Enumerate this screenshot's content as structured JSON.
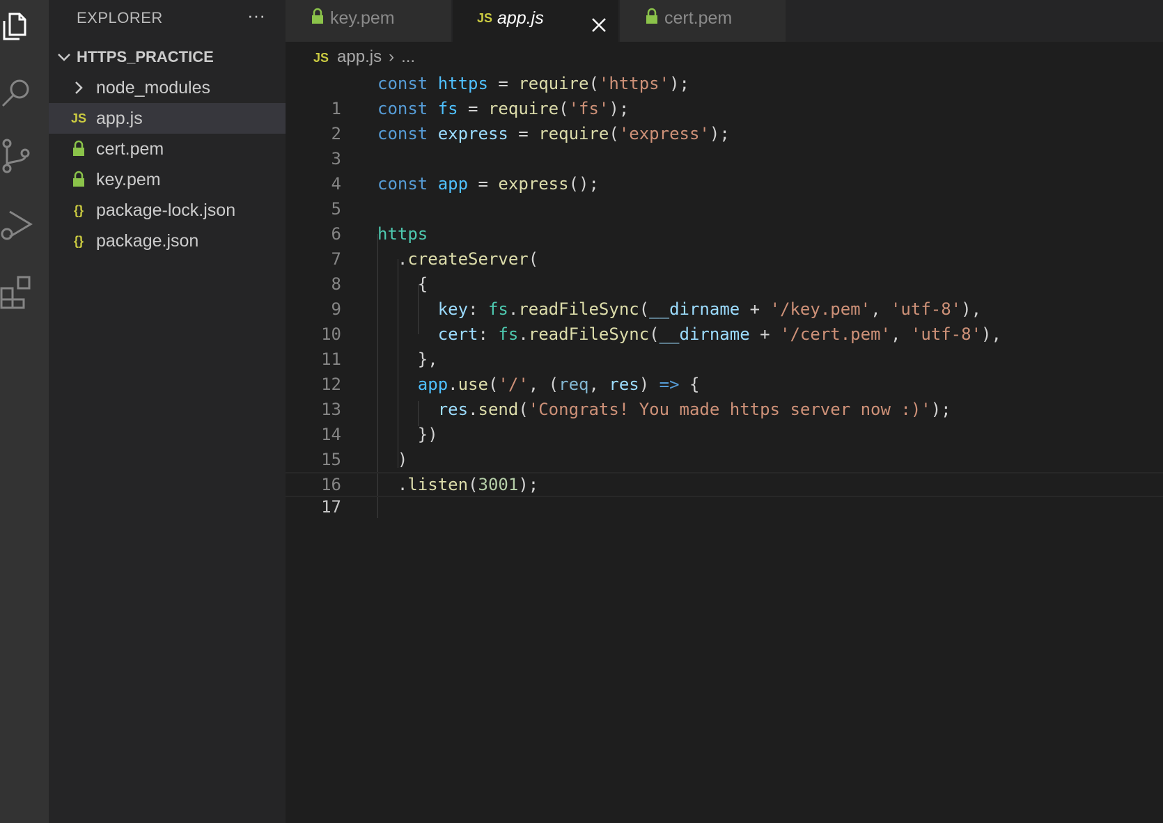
{
  "sidebar": {
    "header": "EXPLORER",
    "more": "···",
    "folder": "HTTPS_PRACTICE",
    "items": [
      {
        "label": "node_modules",
        "icon": "chevron-right-icon",
        "badge": ""
      },
      {
        "label": "app.js",
        "icon": "js-file-icon",
        "badge": "JS"
      },
      {
        "label": "cert.pem",
        "icon": "lock-icon",
        "badge": ""
      },
      {
        "label": "key.pem",
        "icon": "lock-icon",
        "badge": ""
      },
      {
        "label": "package-lock.json",
        "icon": "json-file-icon",
        "badge": "{}"
      },
      {
        "label": "package.json",
        "icon": "json-file-icon",
        "badge": "{}"
      }
    ]
  },
  "tabs": [
    {
      "label": "key.pem",
      "icon": "lock-icon"
    },
    {
      "label": "app.js",
      "icon": "js-file-icon",
      "badge": "JS",
      "active": true
    },
    {
      "label": "cert.pem",
      "icon": "lock-icon"
    }
  ],
  "breadcrumb": {
    "badge": "JS",
    "file": "app.js",
    "more": "..."
  },
  "editor": {
    "current_line": 17,
    "line_numbers": [
      "1",
      "2",
      "3",
      "4",
      "5",
      "6",
      "7",
      "8",
      "9",
      "10",
      "11",
      "12",
      "13",
      "14",
      "15",
      "16",
      "17"
    ],
    "tokens": {
      "l1": [
        "const",
        " ",
        "https",
        " = ",
        "require",
        "(",
        "'https'",
        ");"
      ],
      "l2": [
        "const",
        " ",
        "fs",
        " = ",
        "require",
        "(",
        "'fs'",
        ");"
      ],
      "l3": [
        "const",
        " ",
        "express",
        " = ",
        "require",
        "(",
        "'express'",
        ");"
      ],
      "l5": [
        "const",
        " ",
        "app",
        " = ",
        "express",
        "();"
      ],
      "l7": [
        "https"
      ],
      "l8": [
        "  .",
        "createServer",
        "("
      ],
      "l9": [
        "    {"
      ],
      "l10": [
        "      ",
        "key",
        ": ",
        "fs",
        ".",
        "readFileSync",
        "(",
        "__dirname",
        " + ",
        "'/key.pem'",
        ", ",
        "'utf-8'",
        "),"
      ],
      "l11": [
        "      ",
        "cert",
        ": ",
        "fs",
        ".",
        "readFileSync",
        "(",
        "__dirname",
        " + ",
        "'/cert.pem'",
        ", ",
        "'utf-8'",
        "),"
      ],
      "l12": [
        "    },"
      ],
      "l13": [
        "    ",
        "app",
        ".",
        "use",
        "(",
        "'/'",
        ", (",
        "req",
        ", ",
        "res",
        ") ",
        "=>",
        " {"
      ],
      "l14": [
        "      ",
        "res",
        ".",
        "send",
        "(",
        "'Congrats! You made https server now :)'",
        ");"
      ],
      "l15": [
        "    })"
      ],
      "l16": [
        "  )"
      ],
      "l17": [
        "  .",
        "listen",
        "(",
        "3001",
        ");"
      ]
    }
  },
  "colors": {
    "activity_bar": "#333333",
    "sidebar": "#252526",
    "editor": "#1e1e1e",
    "lock": "#8bc34a",
    "js_badge": "#cbcb41"
  }
}
